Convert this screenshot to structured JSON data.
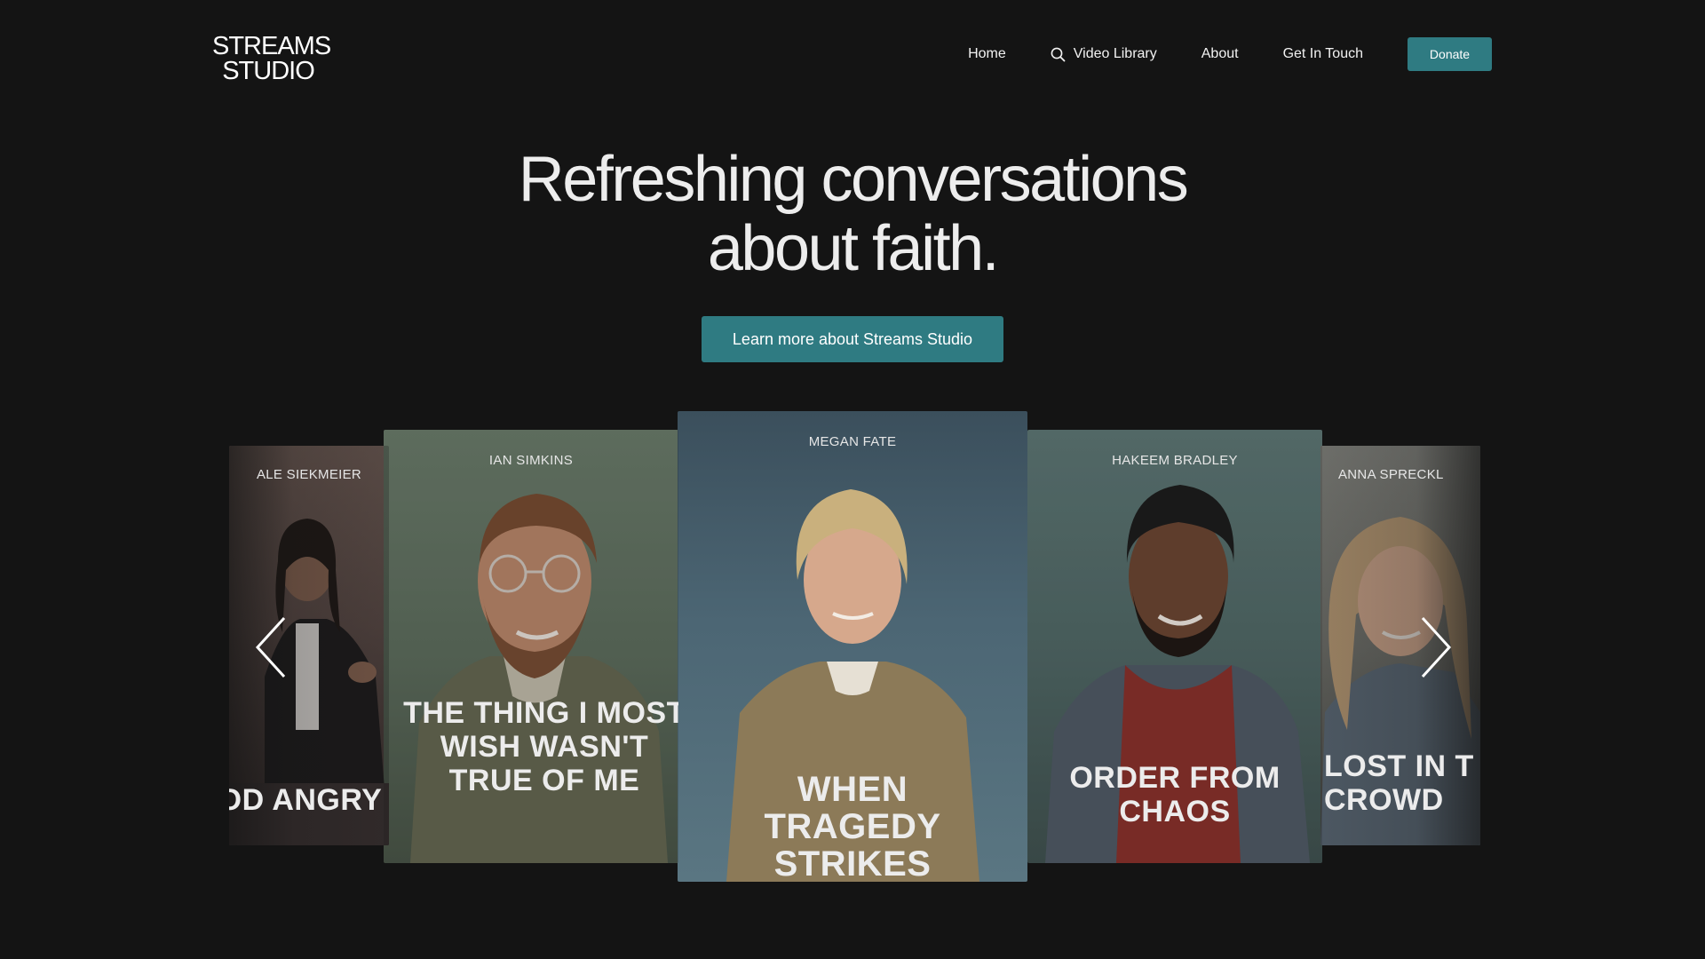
{
  "header": {
    "logo_line1": "STREAMS",
    "logo_line2": "STUDIO",
    "nav": {
      "home": "Home",
      "video_library": "Video Library",
      "about": "About",
      "get_in_touch": "Get In Touch",
      "donate": "Donate"
    }
  },
  "hero": {
    "title_line1": "Refreshing conversations",
    "title_line2": "about faith.",
    "cta_label": "Learn more about Streams Studio"
  },
  "carousel": {
    "cards": [
      {
        "name": "ALE SIEKMEIER",
        "headline": "OD ANGRY"
      },
      {
        "name": "IAN SIMKINS",
        "headline": "THE THING I MOST WISH WASN'T TRUE OF ME"
      },
      {
        "name": "MEGAN FATE",
        "headline": "WHEN TRAGEDY STRIKES"
      },
      {
        "name": "HAKEEM BRADLEY",
        "headline": "ORDER FROM CHAOS"
      },
      {
        "name": "ANNA SPRECKL",
        "headline": "LOST IN T CROWD"
      }
    ],
    "prev_icon": "chevron-left-icon",
    "next_icon": "chevron-right-icon"
  },
  "colors": {
    "background": "#141414",
    "accent": "#2f7b82",
    "text": "#f2f2f2"
  }
}
